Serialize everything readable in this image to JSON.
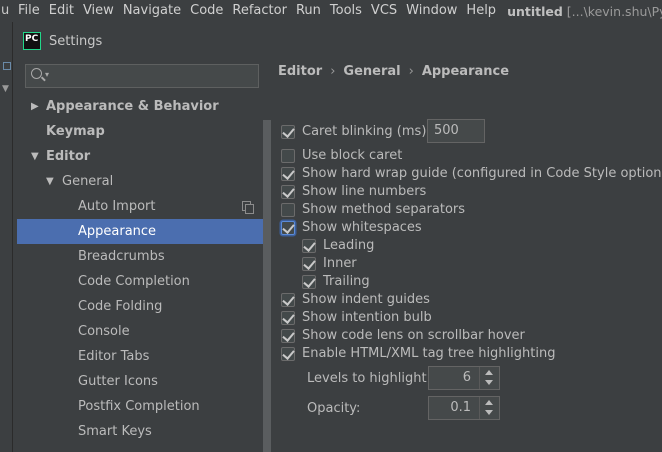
{
  "menubar": {
    "edge_char": "u",
    "items": [
      "File",
      "Edit",
      "View",
      "Navigate",
      "Code",
      "Refactor",
      "Run",
      "Tools",
      "VCS",
      "Window",
      "Help"
    ],
    "project": "untitled",
    "path": "[...\\kevin.shu\\Pych"
  },
  "dialog": {
    "logo_text": "PC",
    "title": "Settings"
  },
  "tree": [
    {
      "label": "Appearance & Behavior",
      "level": 0,
      "arrow": "right",
      "bold": true
    },
    {
      "label": "Keymap",
      "level": 0,
      "arrow": "",
      "bold": true
    },
    {
      "label": "Editor",
      "level": 0,
      "arrow": "down",
      "bold": true
    },
    {
      "label": "General",
      "level": 1,
      "arrow": "down",
      "bold": false
    },
    {
      "label": "Auto Import",
      "level": 2,
      "arrow": "",
      "bold": false,
      "copy_icon": true
    },
    {
      "label": "Appearance",
      "level": 2,
      "arrow": "",
      "bold": false,
      "selected": true
    },
    {
      "label": "Breadcrumbs",
      "level": 2,
      "arrow": "",
      "bold": false
    },
    {
      "label": "Code Completion",
      "level": 2,
      "arrow": "",
      "bold": false
    },
    {
      "label": "Code Folding",
      "level": 2,
      "arrow": "",
      "bold": false
    },
    {
      "label": "Console",
      "level": 2,
      "arrow": "",
      "bold": false
    },
    {
      "label": "Editor Tabs",
      "level": 2,
      "arrow": "",
      "bold": false
    },
    {
      "label": "Gutter Icons",
      "level": 2,
      "arrow": "",
      "bold": false
    },
    {
      "label": "Postfix Completion",
      "level": 2,
      "arrow": "",
      "bold": false
    },
    {
      "label": "Smart Keys",
      "level": 2,
      "arrow": "",
      "bold": false
    }
  ],
  "breadcrumb": {
    "items": [
      "Editor",
      "General",
      "Appearance"
    ],
    "separator": "›"
  },
  "settings": {
    "caret_blinking": {
      "label": "Caret blinking (ms):",
      "checked": true,
      "value": "500"
    },
    "options": [
      {
        "label": "Use block caret",
        "checked": false,
        "indent": 0
      },
      {
        "label": "Show hard wrap guide (configured in Code Style options)",
        "checked": true,
        "indent": 0
      },
      {
        "label": "Show line numbers",
        "checked": true,
        "indent": 0
      },
      {
        "label": "Show method separators",
        "checked": false,
        "indent": 0
      },
      {
        "label": "Show whitespaces",
        "checked": true,
        "indent": 0,
        "focused": true
      },
      {
        "label": "Leading",
        "checked": true,
        "indent": 1
      },
      {
        "label": "Inner",
        "checked": true,
        "indent": 1
      },
      {
        "label": "Trailing",
        "checked": true,
        "indent": 1
      },
      {
        "label": "Show indent guides",
        "checked": true,
        "indent": 0
      },
      {
        "label": "Show intention bulb",
        "checked": true,
        "indent": 0
      },
      {
        "label": "Show code lens on scrollbar hover",
        "checked": true,
        "indent": 0
      },
      {
        "label": "Enable HTML/XML tag tree highlighting",
        "checked": true,
        "indent": 0
      }
    ],
    "levels_to_highlight": {
      "label": "Levels to highlight:",
      "value": "6"
    },
    "opacity": {
      "label": "Opacity:",
      "value": "0.1"
    }
  }
}
